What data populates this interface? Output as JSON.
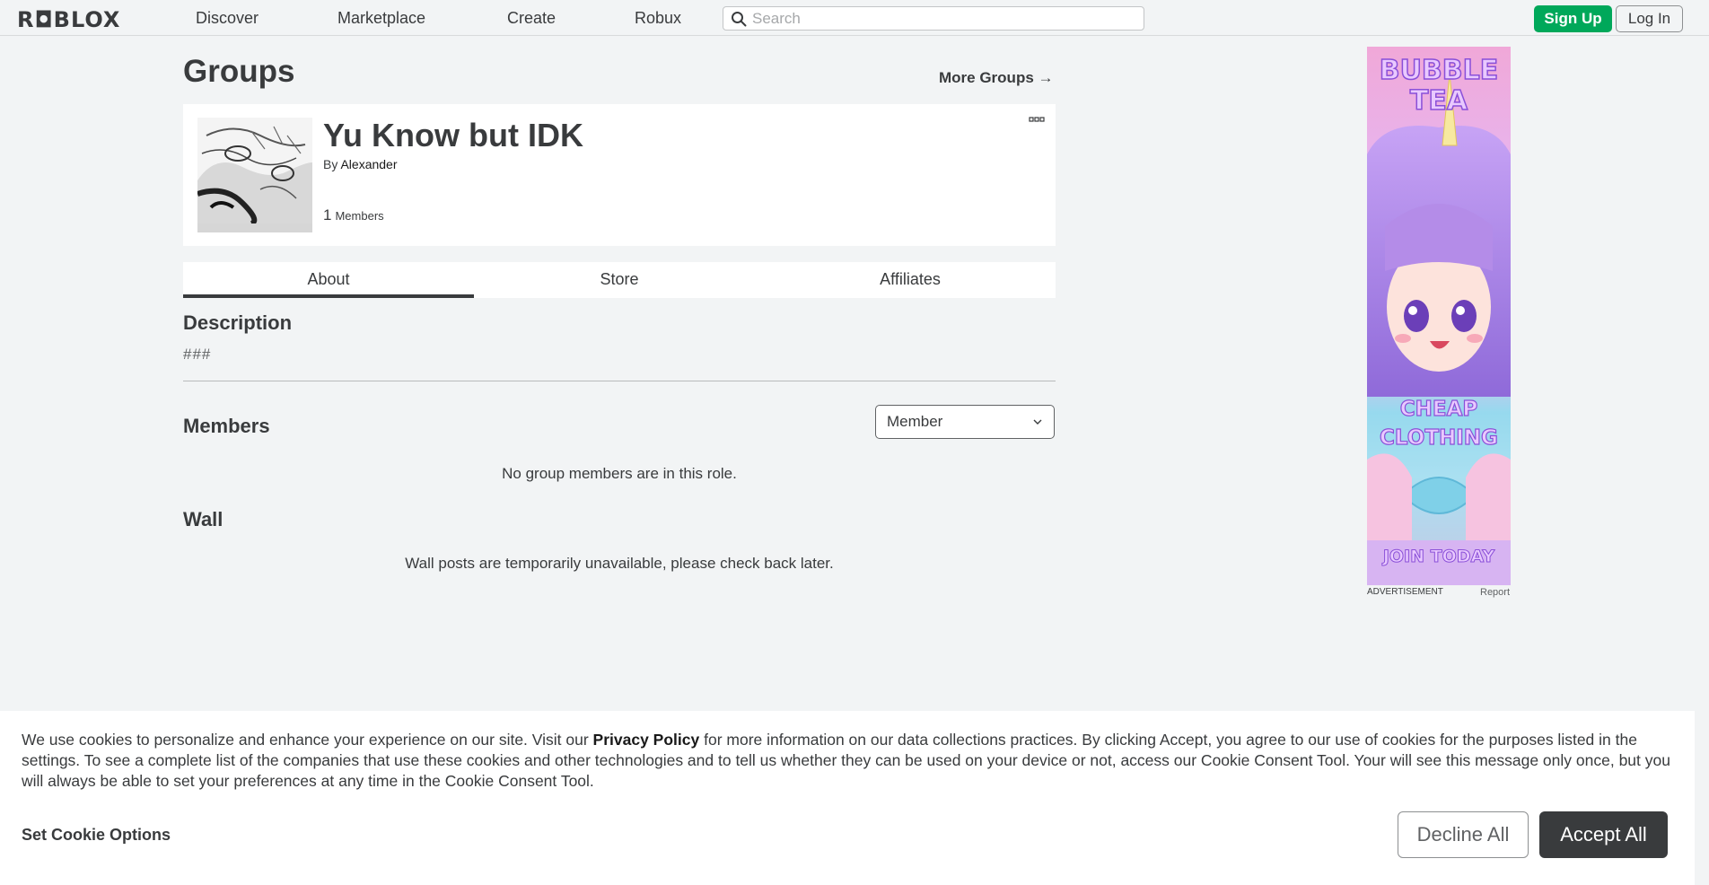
{
  "header": {
    "logo": "R◘BLOX",
    "nav": [
      "Discover",
      "Marketplace",
      "Create",
      "Robux"
    ],
    "search_placeholder": "Search",
    "signup_label": "Sign Up",
    "login_label": "Log In"
  },
  "page": {
    "title": "Groups",
    "more_groups": "More Groups",
    "more_groups_arrow": "→"
  },
  "group": {
    "name": "Yu Know but IDK",
    "by_prefix": "By",
    "owner": "Alexander",
    "member_count": "1",
    "member_label": "Members"
  },
  "tabs": [
    {
      "label": "About",
      "active": true
    },
    {
      "label": "Store",
      "active": false
    },
    {
      "label": "Affiliates",
      "active": false
    }
  ],
  "about": {
    "description_heading": "Description",
    "description_text": "###",
    "members_heading": "Members",
    "role_selected": "Member",
    "members_empty": "No group members are in this role.",
    "wall_heading": "Wall",
    "wall_message": "Wall posts are temporarily unavailable, please check back later."
  },
  "ad": {
    "title_line1": "BUBBLE",
    "title_line2": "TEA",
    "mid_line1": "CHEAP",
    "mid_line2": "CLOTHING",
    "cta": "JOIN TODAY",
    "label": "ADVERTISEMENT",
    "report": "Report"
  },
  "cookie": {
    "text_before": "We use cookies to personalize and enhance your experience on our site. Visit our ",
    "privacy_link": "Privacy Policy",
    "text_after": " for more information on our data collections practices. By clicking Accept, you agree to our use of cookies for the purposes listed in the settings. To see a complete list of the companies that use these cookies and other technologies and to tell us whether they can be used on your device or not, access our Cookie Consent Tool. Your will see this message only once, but you will always be able to set your preferences at any time in the Cookie Consent Tool.",
    "options_label": "Set Cookie Options",
    "decline_label": "Decline All",
    "accept_label": "Accept All"
  },
  "colors": {
    "signup_green": "#00a85a",
    "text_dark": "#393b3d",
    "accept_bg": "#393b3d"
  }
}
